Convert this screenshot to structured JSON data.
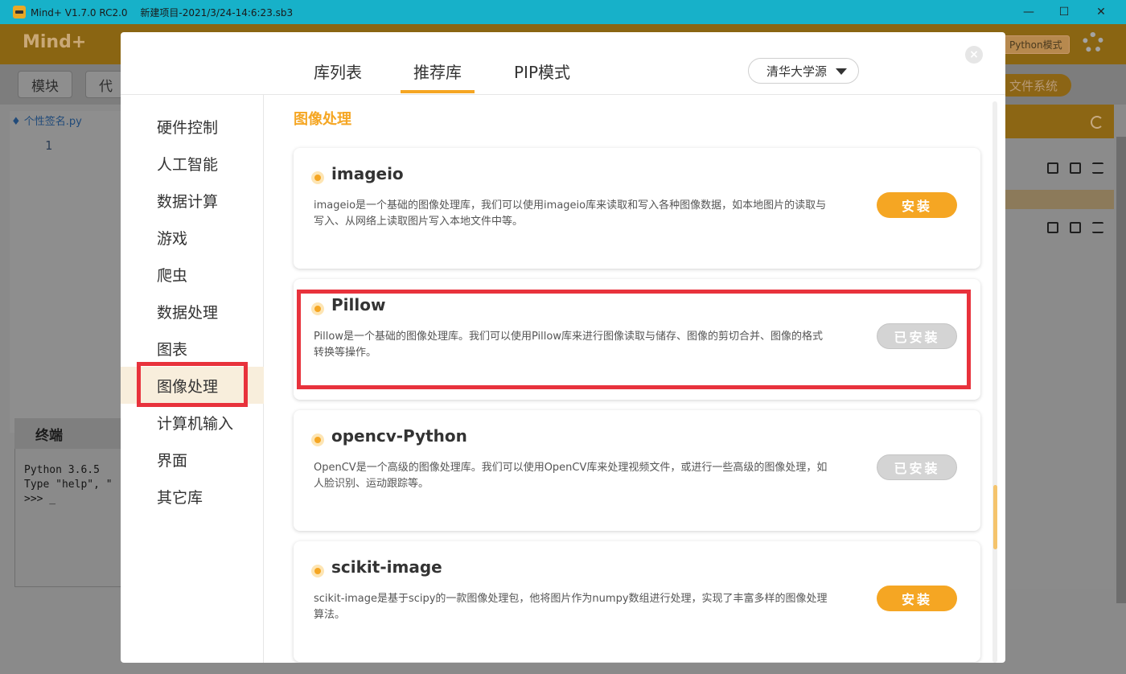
{
  "window": {
    "app_title": "Mind+ V1.7.0 RC2.0",
    "project_title": "新建项目-2021/3/24-14:6:23.sb3",
    "minimize_glyph": "—",
    "maximize_glyph": "☐",
    "close_glyph": "✕"
  },
  "background_app": {
    "logo": "Mind+",
    "mode_button": "Python模式",
    "tab_modules": "模块",
    "tab_code": "代",
    "file_system_button": "文件系统",
    "editor_tab": "个性签名.py",
    "line_number": "1",
    "terminal_title": "终端",
    "terminal_lines": "Python 3.6.5\nType \"help\", \"\n>>> _"
  },
  "dialog": {
    "tabs": [
      "库列表",
      "推荐库",
      "PIP模式"
    ],
    "active_tab": "推荐库",
    "source_select": "清华大学源",
    "close_glyph": "×",
    "categories": [
      "硬件控制",
      "人工智能",
      "数据计算",
      "游戏",
      "爬虫",
      "数据处理",
      "图表",
      "图像处理",
      "计算机输入",
      "界面",
      "其它库"
    ],
    "active_category": "图像处理",
    "section_title": "图像处理",
    "libraries": [
      {
        "name": "imageio",
        "description": "imageio是一个基础的图像处理库，我们可以使用imageio库来读取和写入各种图像数据，如本地图片的读取与写入、从网络上读取图片写入本地文件中等。",
        "button": "安装",
        "status": "install"
      },
      {
        "name": "Pillow",
        "description": "Pillow是一个基础的图像处理库。我们可以使用Pillow库来进行图像读取与储存、图像的剪切合并、图像的格式转换等操作。",
        "button": "已安装",
        "status": "installed"
      },
      {
        "name": "opencv-Python",
        "description": "OpenCV是一个高级的图像处理库。我们可以使用OpenCV库来处理视频文件，或进行一些高级的图像处理，如人脸识别、运动跟踪等。",
        "button": "已安装",
        "status": "installed"
      },
      {
        "name": "scikit-image",
        "description": "scikit-image是基于scipy的一款图像处理包，他将图片作为numpy数组进行处理，实现了丰富多样的图像处理算法。",
        "button": "安装",
        "status": "install"
      }
    ]
  },
  "colors": {
    "accent": "#f5a623",
    "highlight_box": "#e8323c",
    "title_bar": "#17b1c9"
  }
}
